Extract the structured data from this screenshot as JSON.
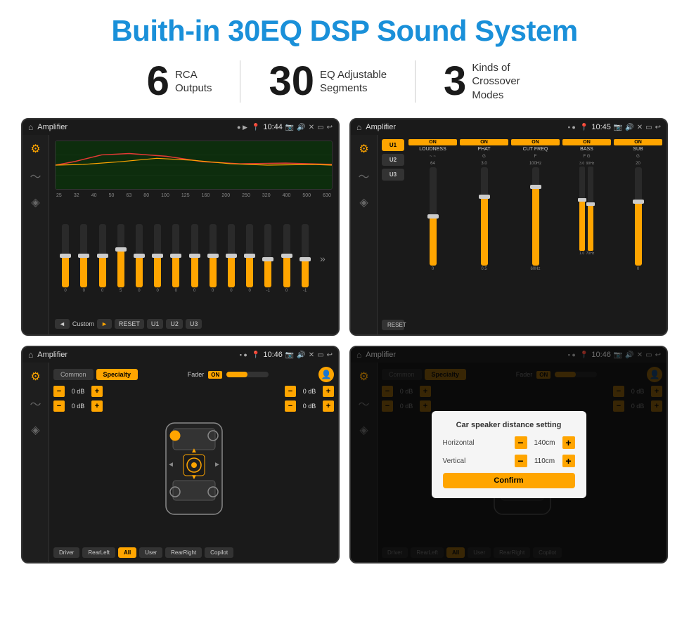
{
  "title": "Buith-in 30EQ DSP Sound System",
  "stats": [
    {
      "number": "6",
      "label": "RCA\nOutputs"
    },
    {
      "number": "30",
      "label": "EQ Adjustable\nSegments"
    },
    {
      "number": "3",
      "label": "Kinds of\nCrossover Modes"
    }
  ],
  "screens": [
    {
      "id": "eq-screen",
      "app_name": "Amplifier",
      "time": "10:44",
      "type": "equalizer",
      "freq_labels": [
        "25",
        "32",
        "40",
        "50",
        "63",
        "80",
        "100",
        "125",
        "160",
        "200",
        "250",
        "320",
        "400",
        "500",
        "630"
      ],
      "slider_values": [
        "0",
        "0",
        "0",
        "5",
        "0",
        "0",
        "0",
        "0",
        "0",
        "0",
        "0",
        "-1",
        "0",
        "-1"
      ],
      "eq_label": "Custom",
      "buttons": [
        "RESET",
        "U1",
        "U2",
        "U3"
      ]
    },
    {
      "id": "crossover-screen",
      "app_name": "Amplifier",
      "time": "10:45",
      "type": "crossover",
      "presets": [
        "U1",
        "U2",
        "U3"
      ],
      "channels": [
        {
          "name": "LOUDNESS",
          "on": true
        },
        {
          "name": "PHAT",
          "on": true
        },
        {
          "name": "CUT FREQ",
          "on": true
        },
        {
          "name": "BASS",
          "on": true
        },
        {
          "name": "SUB",
          "on": true
        }
      ]
    },
    {
      "id": "speaker-setup-screen",
      "app_name": "Amplifier",
      "time": "10:46",
      "type": "speaker-setup",
      "tabs": [
        "Common",
        "Specialty"
      ],
      "active_tab": "Specialty",
      "fader_label": "Fader",
      "fader_on": true,
      "db_values": [
        "0 dB",
        "0 dB",
        "0 dB",
        "0 dB"
      ],
      "buttons": [
        "Driver",
        "RearLeft",
        "All",
        "User",
        "RearRight",
        "Copilot"
      ]
    },
    {
      "id": "distance-setting-screen",
      "app_name": "Amplifier",
      "time": "10:46",
      "type": "distance-setting",
      "tabs": [
        "Common",
        "Specialty"
      ],
      "dialog": {
        "title": "Car speaker distance setting",
        "horizontal_label": "Horizontal",
        "horizontal_value": "140cm",
        "vertical_label": "Vertical",
        "vertical_value": "110cm",
        "confirm_label": "Confirm"
      },
      "db_values": [
        "0 dB",
        "0 dB"
      ],
      "buttons": [
        "Driver",
        "RearLeft",
        "All",
        "User",
        "RearRight",
        "Copilot"
      ]
    }
  ]
}
